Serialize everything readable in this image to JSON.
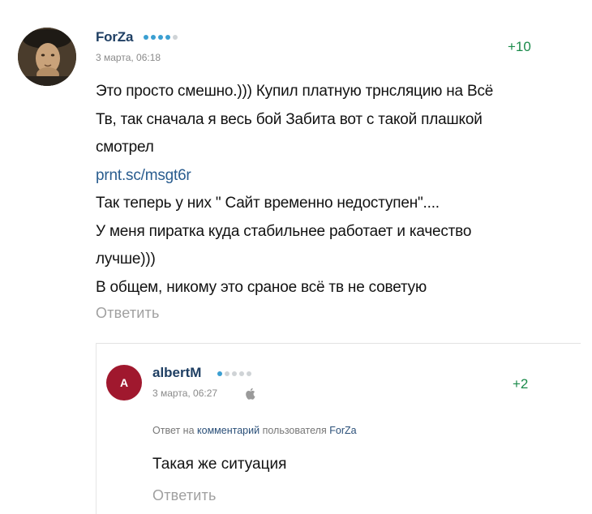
{
  "comment": {
    "author": "ForZa",
    "timestamp": "3 марта, 06:18",
    "score": "+10",
    "rating_colors": [
      "#3b9fd1",
      "#3b9fd1",
      "#3b9fd1",
      "#3b9fd1",
      "#cfd3d6"
    ],
    "lines": [
      "Это просто смешно.))) Купил платную трнсляцию на Всё",
      "Тв, так сначала я весь бой Забита вот с такой плашкой",
      "смотрел",
      "prnt.sc/msgt6r",
      "Так теперь у них \" Сайт временно недоступен\"....",
      "У меня пиратка куда стабильнее работает и качество",
      "лучше)))",
      "В общем, никому это сраное всё тв не советую"
    ],
    "reply_label": "Ответить"
  },
  "reply": {
    "avatar_letter": "A",
    "author": "albertM",
    "timestamp": "3 марта, 06:27",
    "score": "+2",
    "rating_colors": [
      "#3b9fd1",
      "#cfd3d6",
      "#cfd3d6",
      "#cfd3d6",
      "#cfd3d6"
    ],
    "reply_to_prefix": "Ответ на",
    "reply_to_link": "комментарий",
    "reply_to_middle": "пользователя",
    "reply_to_user": "ForZa",
    "text": "Такая же ситуация",
    "reply_label": "Ответить",
    "device_icon": "apple-icon"
  }
}
